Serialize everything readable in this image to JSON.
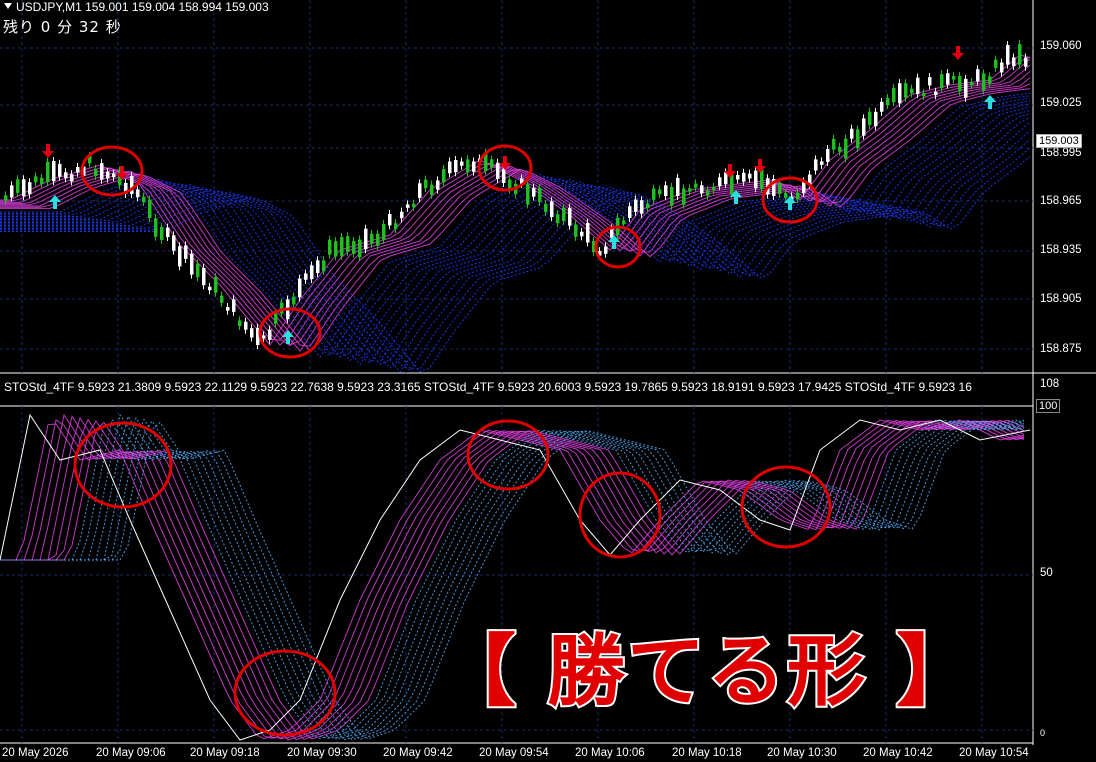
{
  "header": {
    "title": "USDJPY,M1  159.001 159.004 158.994 159.003"
  },
  "countdown": "残り 0 分 32 秒",
  "price_axis": [
    "159.060",
    "159.025",
    "158.995",
    "158.965",
    "158.935",
    "158.905",
    "158.875"
  ],
  "current_price": "159.003",
  "indicator_header": "STOStd_4TF 9.5923 21.3809 9.5923 22.1129 9.5923 22.7638 9.5923 23.3165  STOStd_4TF 9.5923 20.6003 9.5923 19.7865 9.5923 18.9191 9.5923 17.9425  STOStd_4TF 9.5923 16",
  "indicator_axis": {
    "top": "108",
    "high": "100",
    "mid": "50",
    "low": "0"
  },
  "time_axis": [
    "20 May 2026",
    "20 May 09:06",
    "20 May 09:18",
    "20 May 09:30",
    "20 May 09:42",
    "20 May 09:54",
    "20 May 10:06",
    "20 May 10:18",
    "20 May 10:30",
    "20 May 10:42",
    "20 May 10:54"
  ],
  "banner": "【 勝てる形 】",
  "colors": {
    "bull": "#1fbf1f",
    "bear": "#ffffff",
    "ribbon_pink": "#e040e0",
    "ribbon_blue": "#1a3cff",
    "circle": "#e00000",
    "arrow_up": "#29e0e0",
    "arrow_down": "#e00010",
    "grid": "#1a2a6a"
  }
}
